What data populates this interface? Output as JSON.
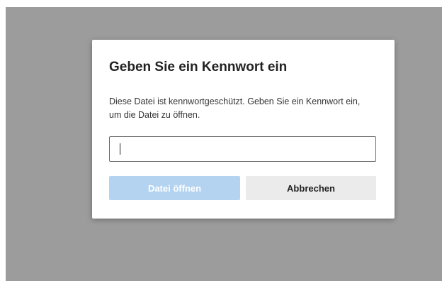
{
  "dialog": {
    "title": "Geben Sie ein Kennwort ein",
    "description": "Diese Datei ist kennwortgeschützt. Geben Sie ein Kennwort ein, um die Datei zu öffnen.",
    "password_value": "",
    "open_button_label": "Datei öffnen",
    "cancel_button_label": "Abbrechen"
  },
  "colors": {
    "backdrop": "#9c9c9c",
    "primary_button_disabled": "#b3d3f0",
    "secondary_button": "#ebebeb"
  }
}
